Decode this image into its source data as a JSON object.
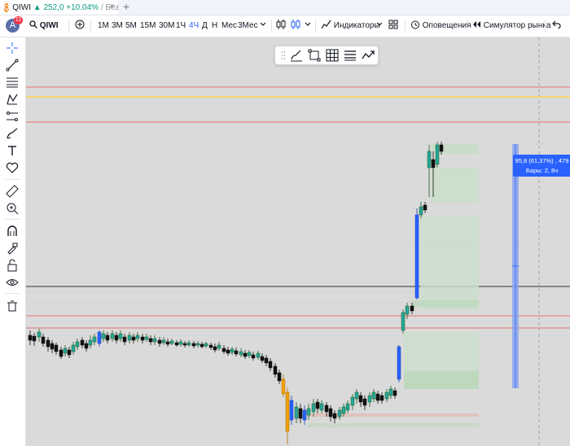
{
  "tab": {
    "logo_letter": "Q",
    "title_symbol": "QIWI",
    "title_price": "▲ 252,0",
    "title_change": "+10.04%",
    "title_rest": "/ Без",
    "close_glyph": "×",
    "add_glyph": "+"
  },
  "toolbar": {
    "avatar_letter": "A",
    "notification_count": "11",
    "symbol": "QIWI",
    "timeframes": [
      "1М",
      "3М",
      "5М",
      "15М",
      "30М",
      "1Ч",
      "4Ч",
      "Д",
      "Н",
      "Мес",
      "3Мес"
    ],
    "active_timeframe": "4Ч",
    "indicators_label": "Индикаторы",
    "alerts_label": "Оповещения",
    "replay_label": "Симулятор рынка"
  },
  "left_tools": [
    "crosshair-icon",
    "trend-line-icon",
    "fib-retracement-icon",
    "pattern-icon",
    "parallel-channel-icon",
    "brush-icon",
    "text-icon",
    "heart-icon",
    "ruler-icon",
    "zoom-in-icon",
    "magnet-icon",
    "lock-drawing-icon",
    "unlock-icon",
    "eye-icon",
    "trash-icon"
  ],
  "measure": {
    "line1": "95,8 (61,37%) , 479",
    "line2": "Бары: 2, 8ч"
  },
  "colors": {
    "chart_bg": "#dadada",
    "bull": "#26a69a",
    "bear": "#000000",
    "highlight_blue": "#2962ff",
    "highlight_orange": "#f0a000",
    "red_level": "#e57373",
    "yellow_level": "#ffd54f",
    "measure_fill": "#8aa4ee"
  }
}
